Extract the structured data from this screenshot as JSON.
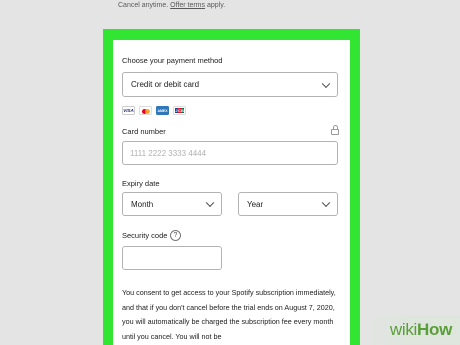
{
  "top": {
    "text_prefix": "Cancel anytime. ",
    "offer_link": "Offer terms",
    "text_suffix": " apply."
  },
  "payment": {
    "heading": "Choose your payment method",
    "method_selected": "Credit or debit card",
    "card_brands": [
      "VISA",
      "Mastercard",
      "AMEX",
      "JCB"
    ]
  },
  "card_number": {
    "label": "Card number",
    "placeholder": "1111 2222 3333 4444"
  },
  "expiry": {
    "label": "Expiry date",
    "month": "Month",
    "year": "Year"
  },
  "security": {
    "label": "Security code",
    "help": "?"
  },
  "consent_text": "You consent to get access to your Spotify subscription immediately, and that if you don't cancel before the trial ends on August 7, 2020, you will automatically be charged the subscription fee every month until you cancel. You will not be",
  "watermark": {
    "wiki": "wiki",
    "how": "How"
  },
  "colors": {
    "highlight": "#33e533",
    "watermark": "#5a9e3a"
  }
}
